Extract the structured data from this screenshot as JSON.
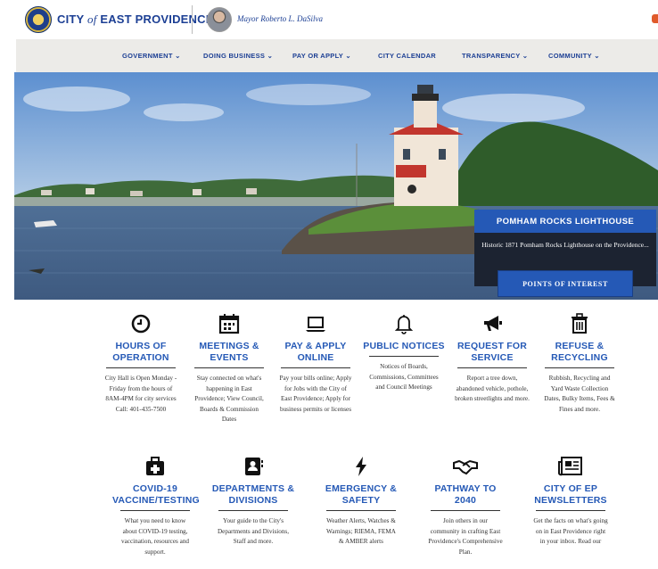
{
  "header": {
    "city_prefix": "CITY ",
    "city_of": "of",
    "city_suffix": " EAST PROVIDENCE",
    "mayor": "Mayor Roberto L. DaSilva"
  },
  "nav": {
    "items": [
      {
        "label": "GOVERNMENT ⌄"
      },
      {
        "label": "DOING BUSINESS ⌄"
      },
      {
        "label": "PAY OR APPLY ⌄"
      },
      {
        "label": "CITY CALENDAR"
      },
      {
        "label": "TRANSPARENCY ⌄"
      },
      {
        "label": "COMMUNITY ⌄"
      }
    ]
  },
  "hero": {
    "title": "POMHAM ROCKS LIGHTHOUSE",
    "text": "Historic 1871 Pomham Rocks Lighthouse on the Providence...",
    "button": "POINTS OF INTEREST"
  },
  "colors": {
    "brand_blue": "#2559b6",
    "title_blue": "#1c3f94",
    "card_dark": "#1c2331"
  },
  "services_row1": [
    {
      "icon": "clock-icon",
      "title": "HOURS OF OPERATION",
      "desc": "City Hall is Open Monday - Friday from the hours of 8AM-4PM for city services Call: 401-435-7500"
    },
    {
      "icon": "calendar-icon",
      "title": "MEETINGS & EVENTS",
      "desc": "Stay connected on what's happening in East Providence; View Council, Boards & Commission Dates"
    },
    {
      "icon": "laptop-icon",
      "title": "PAY & APPLY ONLINE",
      "desc": "Pay your bills online; Apply for Jobs with the City of East Providence; Apply for business permits or licenses"
    },
    {
      "icon": "bell-icon",
      "title": "PUBLIC NOTICES",
      "desc": "Notices of Boards, Commissions, Committees and Council Meetings"
    },
    {
      "icon": "megaphone-icon",
      "title": "REQUEST FOR SERVICE",
      "desc": "Report a tree down, abandoned vehicle, pothole, broken streetlights and more."
    },
    {
      "icon": "trash-icon",
      "title": "REFUSE & RECYCLING",
      "desc": "Rubbish, Recycling and Yard Waste Collection Dates, Bulky Items, Fees & Fines and more."
    }
  ],
  "services_row2": [
    {
      "icon": "medkit-icon",
      "title": "COVID-19 VACCINE/TESTING",
      "desc": "What you need to know about COVID-19 testing, vaccination, resources and support."
    },
    {
      "icon": "contact-card-icon",
      "title": "DEPARTMENTS & DIVISIONS",
      "desc": "Your guide to the City's Departments and Divisions, Staff and more."
    },
    {
      "icon": "lightning-icon",
      "title": "EMERGENCY & SAFETY",
      "desc": "Weather Alerts, Watches & Warnings; RIEMA, FEMA & AMBER alerts"
    },
    {
      "icon": "handshake-icon",
      "title": "PATHWAY TO 2040",
      "desc": "Join others in our community in crafting East Providence's Comprehensive Plan."
    },
    {
      "icon": "newspaper-icon",
      "title": "CITY OF EP NEWSLETTERS",
      "desc": "Get the facts on what's going on in East Providence right in your inbox. Read our"
    }
  ]
}
